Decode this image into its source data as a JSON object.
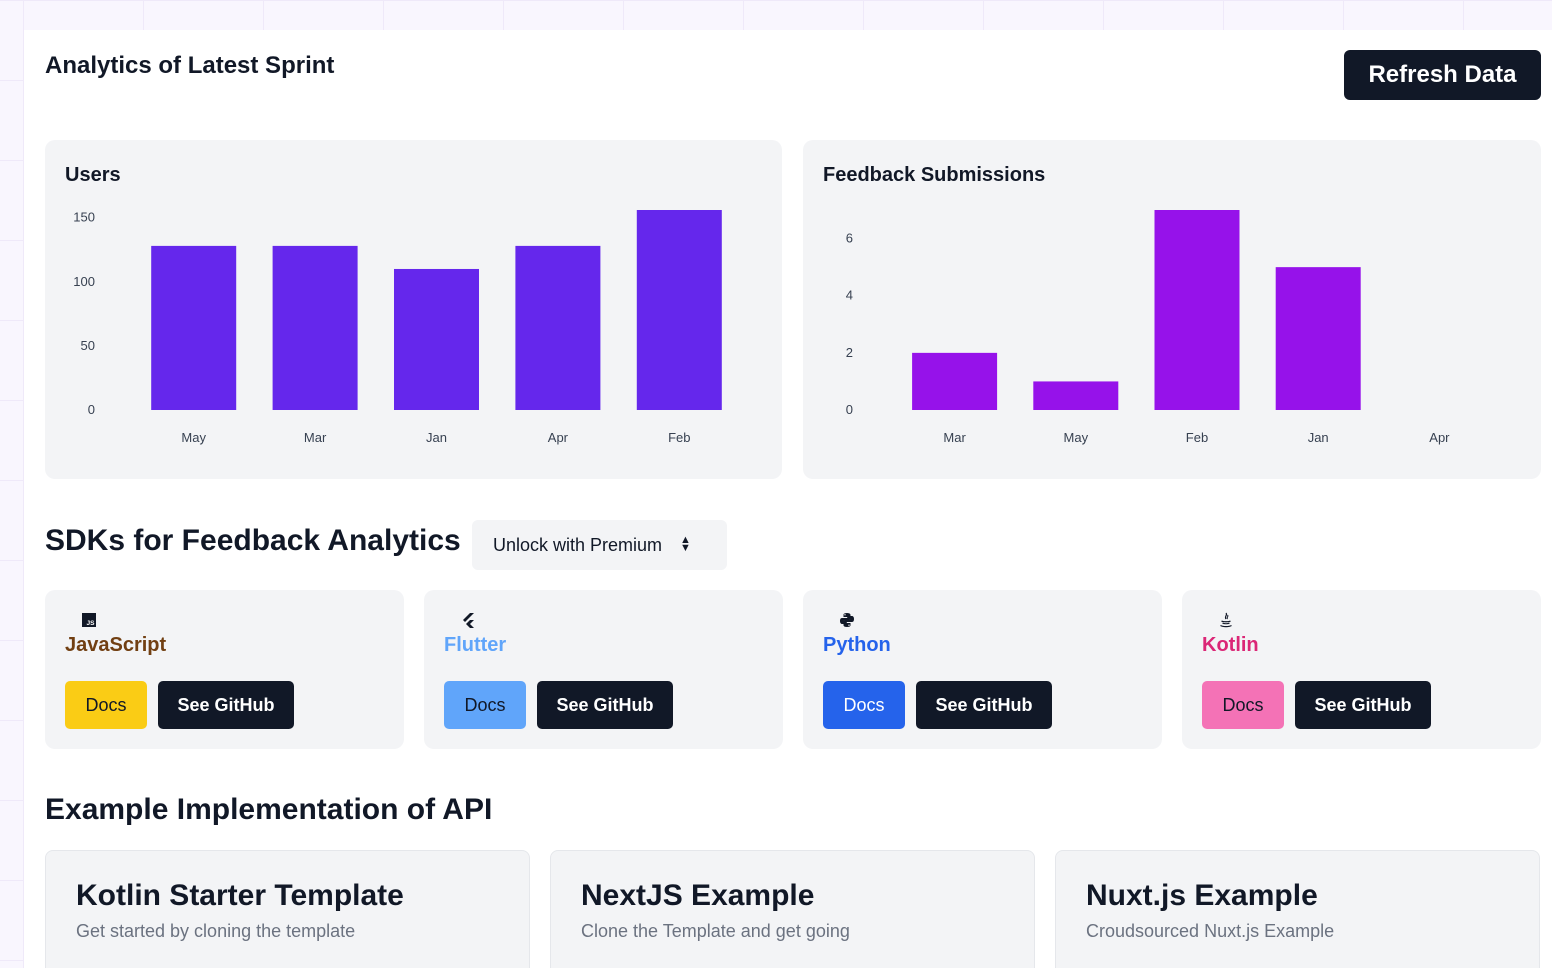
{
  "header": {
    "title": "Analytics of Latest Sprint",
    "refresh_label": "Refresh Data"
  },
  "charts": {
    "users_title": "Users",
    "feedback_title": "Feedback Submissions"
  },
  "chart_data": [
    {
      "type": "bar",
      "title": "Users",
      "categories": [
        "May",
        "Mar",
        "Jan",
        "Apr",
        "Feb"
      ],
      "values": [
        128,
        128,
        110,
        128,
        156
      ],
      "ylim": [
        0,
        156
      ],
      "yticks": [
        "0",
        "50",
        "100",
        "150"
      ],
      "color": "#6527ec"
    },
    {
      "type": "bar",
      "title": "Feedback Submissions",
      "categories": [
        "Mar",
        "May",
        "Feb",
        "Jan",
        "Apr"
      ],
      "values": [
        2,
        1,
        7,
        5,
        0
      ],
      "ylim": [
        0,
        7
      ],
      "yticks": [
        "0",
        "2",
        "4",
        "6"
      ],
      "color": "#9612ea"
    }
  ],
  "sdks": {
    "title": "SDKs for Feedback Analytics",
    "premium_select": "Unlock with Premium",
    "docs_label": "Docs",
    "github_label": "See GitHub",
    "items": [
      {
        "name": "JavaScript",
        "icon": "javascript-icon",
        "name_color": "#713f12",
        "docs_color": "#facc15",
        "docs_text_color": "#111827"
      },
      {
        "name": "Flutter",
        "icon": "flutter-icon",
        "name_color": "#60a5fa",
        "docs_color": "#60a5fa",
        "docs_text_color": "#111827"
      },
      {
        "name": "Python",
        "icon": "python-icon",
        "name_color": "#2563eb",
        "docs_color": "#2563eb",
        "docs_text_color": "#ffffff"
      },
      {
        "name": "Kotlin",
        "icon": "java-icon",
        "name_color": "#db2777",
        "docs_color": "#f472b6",
        "docs_text_color": "#111827"
      }
    ]
  },
  "examples": {
    "title": "Example Implementation of API",
    "items": [
      {
        "title": "Kotlin Starter Template",
        "description": "Get started by cloning the template"
      },
      {
        "title": "NextJS Example",
        "description": "Clone the Template and get going"
      },
      {
        "title": "Nuxt.js Example",
        "description": "Croudsourced Nuxt.js Example"
      }
    ]
  }
}
